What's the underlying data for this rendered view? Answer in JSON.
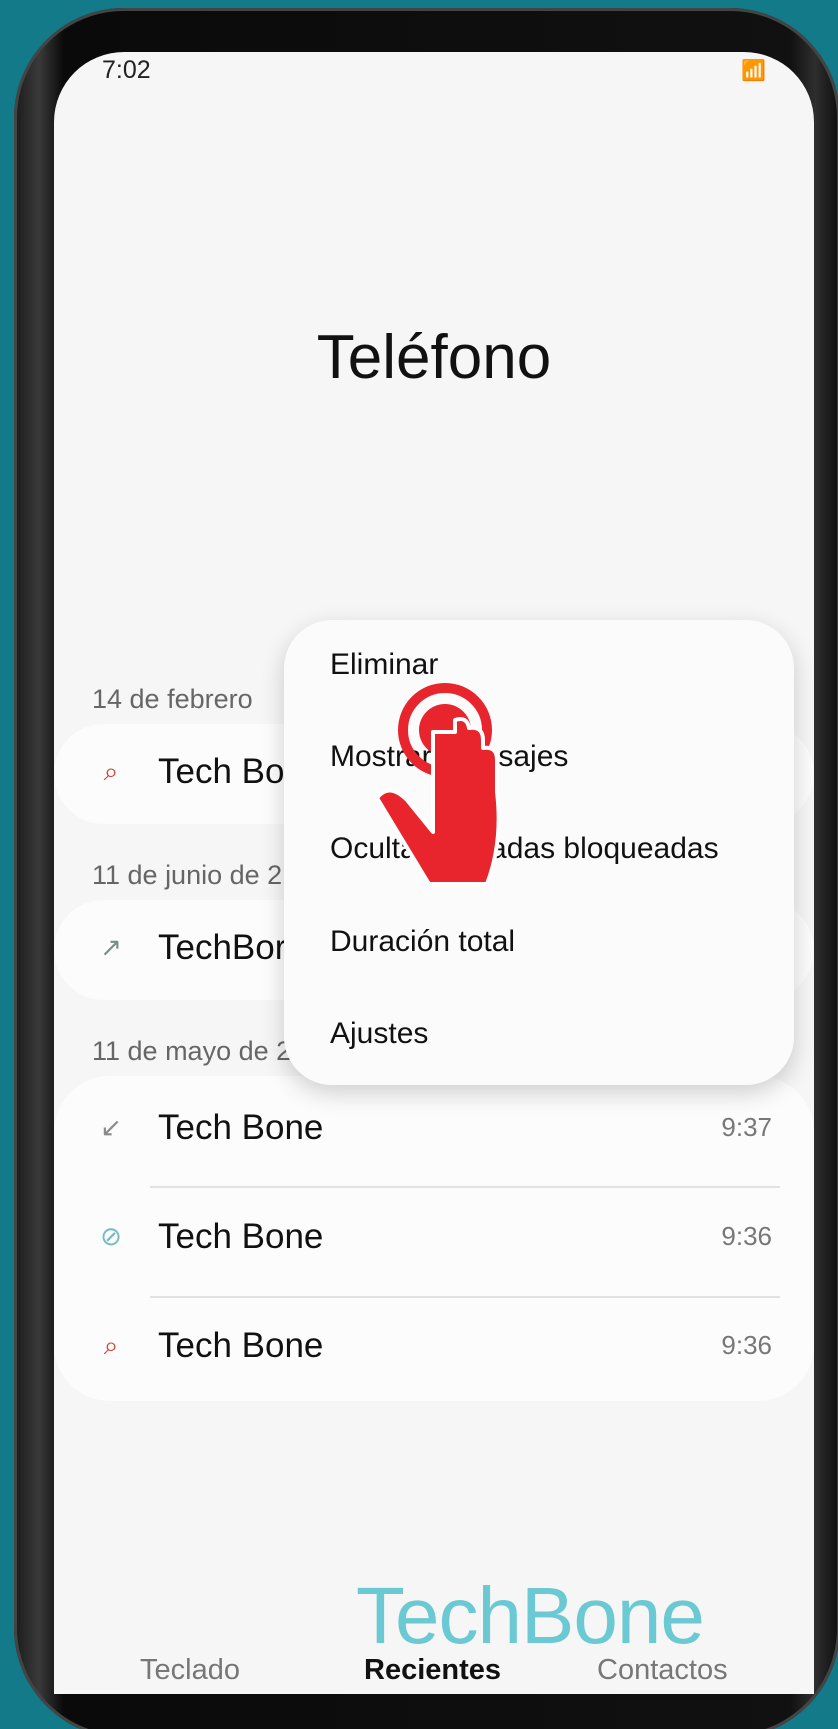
{
  "status_bar": {
    "time": "7:02",
    "icons": "wifi-icon signal-icon signal-icon battery-icon"
  },
  "header": {
    "title": "Teléfono"
  },
  "sections": [
    {
      "date": "14 de febrero",
      "calls": [
        {
          "name": "Tech Bo",
          "type": "missed",
          "time": ""
        }
      ]
    },
    {
      "date": "11 de junio de 2",
      "calls": [
        {
          "name": "TechBor",
          "type": "outgoing",
          "time": ""
        }
      ]
    },
    {
      "date": "11 de mayo de 2021",
      "calls": [
        {
          "name": "Tech Bone",
          "type": "incoming",
          "time": "9:37"
        },
        {
          "name": "Tech Bone",
          "type": "blocked",
          "time": "9:36"
        },
        {
          "name": "Tech Bone",
          "type": "missed",
          "time": "9:36"
        }
      ]
    }
  ],
  "menu": {
    "items": [
      "Eliminar",
      "Mostrar mensajes",
      "Ocultar llamadas bloqueadas",
      "Duración total",
      "Ajustes"
    ]
  },
  "bottom_nav": {
    "tabs": [
      "Teclado",
      "Recientes",
      "Contactos"
    ],
    "active": "Recientes"
  },
  "watermark": "TechBone",
  "colors": {
    "background": "#137a8a",
    "missed": "#d33b2c",
    "hand": "#e8242c",
    "watermark": "#5fc6d0"
  }
}
